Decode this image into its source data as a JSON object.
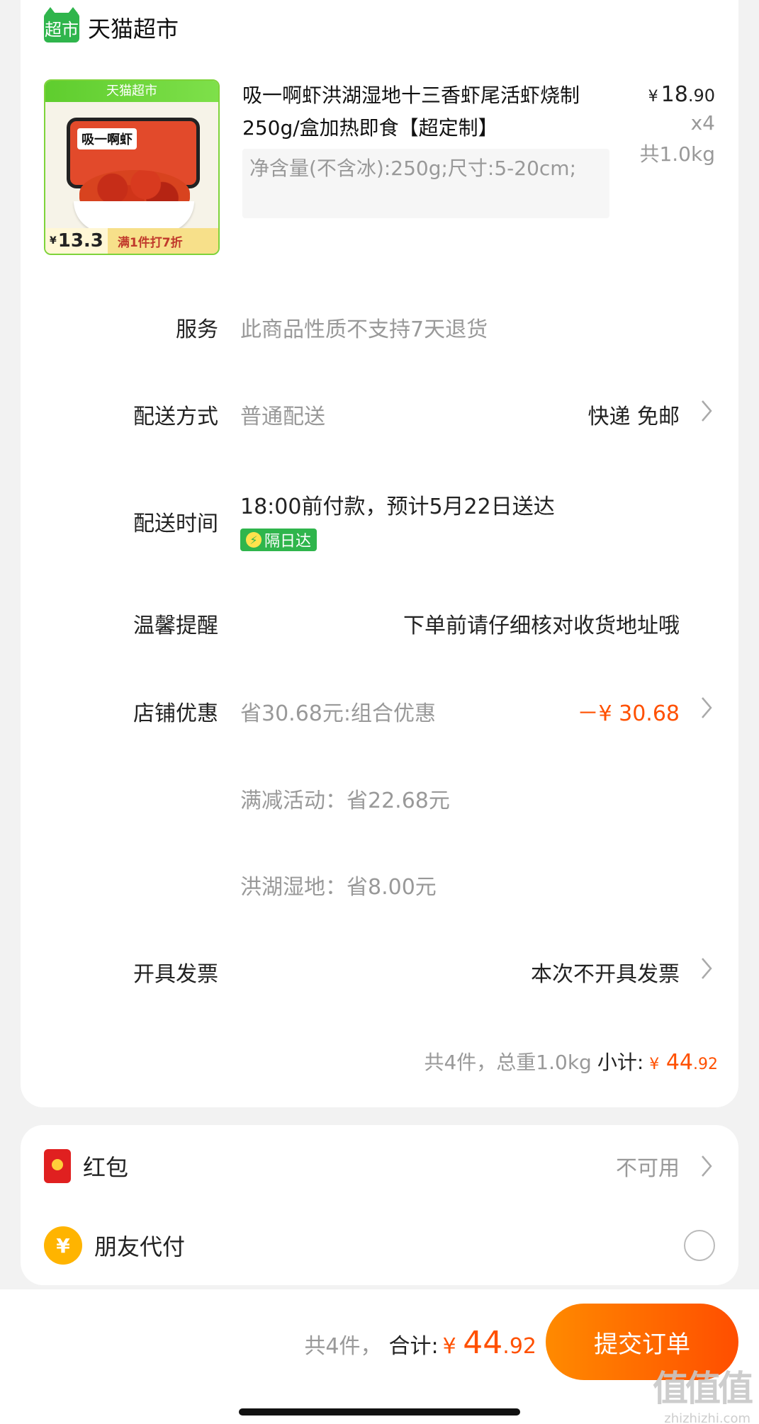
{
  "store": {
    "logo_text": "超市",
    "name": "天猫超市"
  },
  "product": {
    "thumb_top": "天猫超市",
    "thumb_board": "吸一啊虾",
    "thumb_price_yen": "¥",
    "thumb_price": "13.3",
    "thumb_promo": "满1件打7折",
    "title": "吸一啊虾洪湖湿地十三香虾尾活虾烧制250g/盒加热即食【超定制】",
    "spec": "净含量(不含冰):250g;尺寸:5-20cm;",
    "price_yen": "¥",
    "price_int": "18",
    "price_dec": ".90",
    "qty": "x4",
    "weight": "共1.0kg"
  },
  "rows": {
    "service": {
      "label": "服务",
      "value": "此商品性质不支持7天退货"
    },
    "delivery_method": {
      "label": "配送方式",
      "value": "普通配送",
      "right": "快递 免邮"
    },
    "delivery_time": {
      "label": "配送时间",
      "value": "18:00前付款，预计5月22日送达",
      "badge": "隔日达",
      "badge_icon": "⚡"
    },
    "reminder": {
      "label": "温馨提醒",
      "right": "下单前请仔细核对收货地址哦"
    },
    "store_discount": {
      "label": "店铺优惠",
      "value": "省30.68元:组合优惠",
      "right": "－¥ 30.68"
    },
    "discount_1": {
      "value": "满减活动：省22.68元"
    },
    "discount_2": {
      "value": "洪湖湿地：省8.00元"
    },
    "invoice": {
      "label": "开具发票",
      "right": "本次不开具发票"
    }
  },
  "subtotal": {
    "count": "共4件，总重1.0kg",
    "label": "小计:",
    "yen": "¥",
    "int": "44",
    "dec": ".92"
  },
  "extras": {
    "red_packet": {
      "label": "红包",
      "right": "不可用"
    },
    "friend_pay": {
      "label": "朋友代付",
      "icon_glyph": "¥"
    }
  },
  "footer": {
    "count": "共4件，",
    "label": "合计:",
    "yen": "¥",
    "int": "44",
    "dec": ".92",
    "submit": "提交订单"
  },
  "watermark": {
    "big": "值值值",
    "small": "zhizhizhi.com"
  },
  "colors": {
    "accent": "#ff5000",
    "tmall_green": "#2fb54c"
  }
}
